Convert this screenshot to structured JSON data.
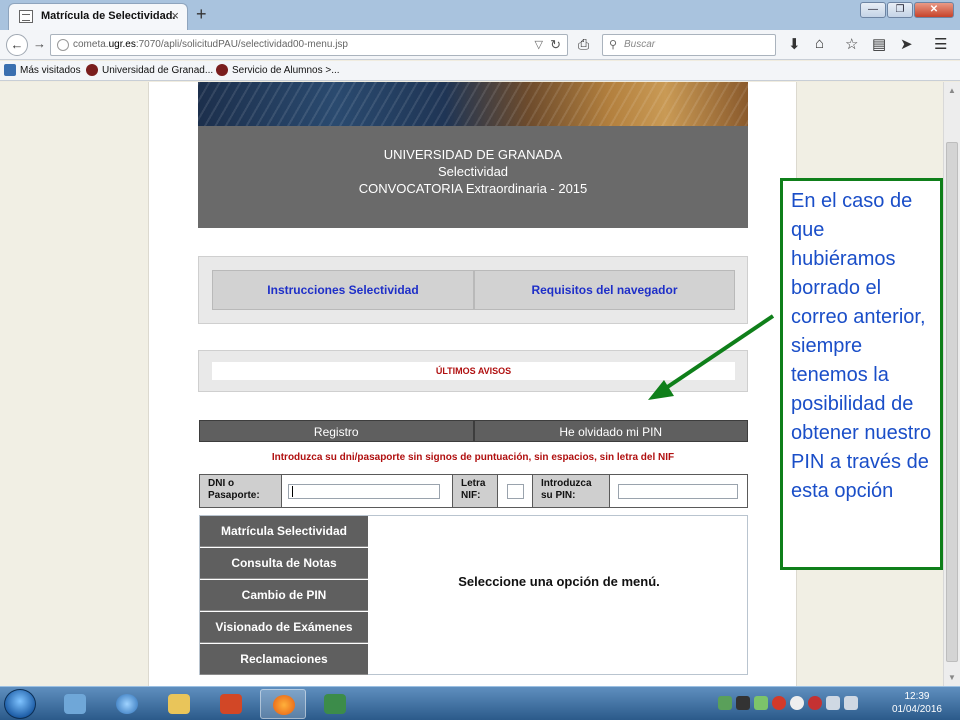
{
  "browser": {
    "tab_title": "Matrícula de Selectividad.",
    "tab_close": "×",
    "new_tab": "+",
    "window_buttons": {
      "minimize": "—",
      "restore": "❐",
      "close": "✕"
    },
    "url_prefix": "cometa.",
    "url_domain": "ugr.es",
    "url_rest": ":7070/apli/solicitudPAU/selectividad00-menu.jsp",
    "search_placeholder": "Buscar",
    "bookmarks": [
      {
        "label": "Más visitados",
        "color": "#3a6fb0"
      },
      {
        "label": "Universidad de Granad...",
        "color": "#7a1d1d"
      },
      {
        "label": "Servicio de Alumnos >...",
        "color": "#7a1d1d"
      }
    ]
  },
  "page": {
    "header_lines": [
      "UNIVERSIDAD DE GRANADA",
      "Selectividad",
      "CONVOCATORIA Extraordinaria - 2015"
    ],
    "links": {
      "instrucciones": "Instrucciones Selectividad",
      "requisitos": "Requisitos del navegador"
    },
    "avisos_title": "ÚLTIMOS AVISOS",
    "tabs": {
      "registro": "Registro",
      "olvido_pin": "He olvidado mi PIN"
    },
    "instructions": "Introduzca su dni/pasaporte sin signos de puntuación, sin espacios, sin letra del NIF",
    "login": {
      "dni_label_1": "DNI o",
      "dni_label_2": "Pasaporte:",
      "letra_label_1": "Letra",
      "letra_label_2": "NIF:",
      "pin_label_1": "Introduzca",
      "pin_label_2": "su PIN:",
      "dni_value": "",
      "letra_value": "",
      "pin_value": ""
    },
    "menu_items": [
      "Matrícula Selectividad",
      "Consulta de Notas",
      "Cambio de PIN",
      "Visionado de Exámenes",
      "Reclamaciones"
    ],
    "menu_message": "Seleccione una opción de menú."
  },
  "annotation": {
    "text": "En el caso de que hubiéramos borrado el correo anterior, siempre tenemos la posibilidad de obtener nuestro PIN a través de esta opción",
    "border_color": "#0f7f1a",
    "text_color": "#1a4ec8"
  },
  "taskbar": {
    "time": "12:39",
    "date": "01/04/2016"
  }
}
